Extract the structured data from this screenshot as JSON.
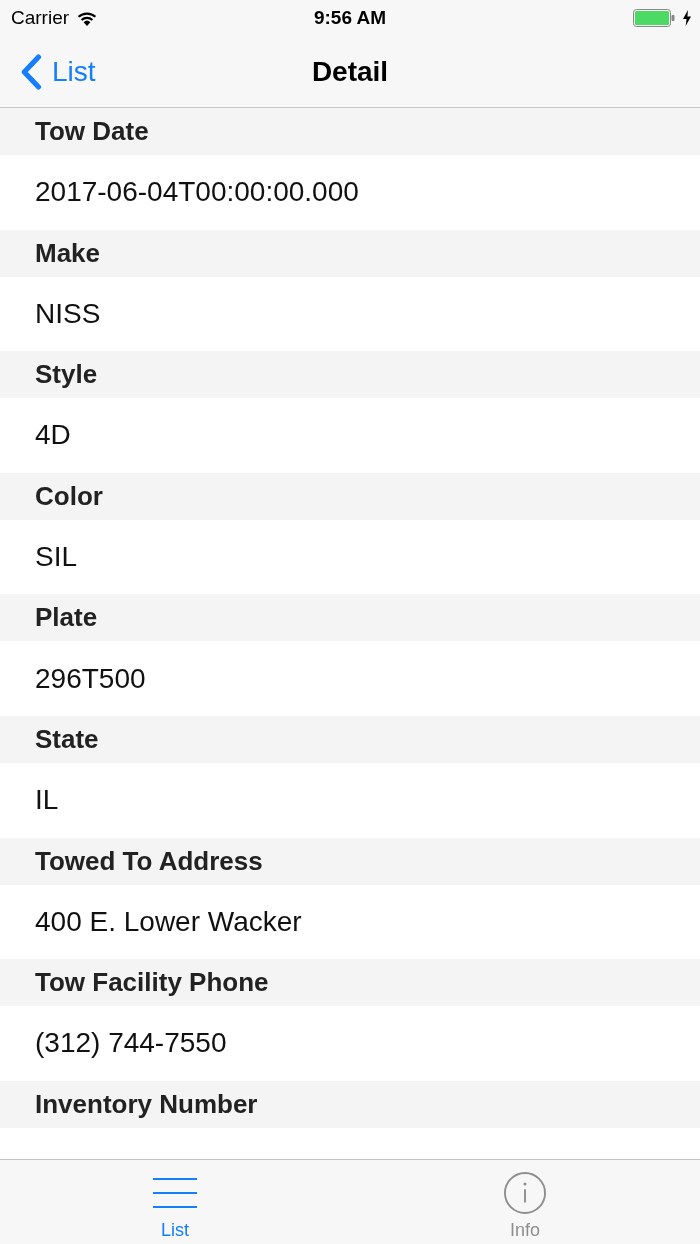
{
  "status_bar": {
    "carrier": "Carrier",
    "time": "9:56 AM",
    "charging": true
  },
  "nav_bar": {
    "back_label": "List",
    "title": "Detail"
  },
  "fields": [
    {
      "label": "Tow Date",
      "value": "2017-06-04T00:00:00.000"
    },
    {
      "label": "Make",
      "value": "NISS"
    },
    {
      "label": "Style",
      "value": "4D"
    },
    {
      "label": "Color",
      "value": "SIL"
    },
    {
      "label": "Plate",
      "value": "296T500"
    },
    {
      "label": "State",
      "value": "IL"
    },
    {
      "label": "Towed To Address",
      "value": "400 E. Lower Wacker"
    },
    {
      "label": "Tow Facility Phone",
      "value": "(312) 744-7550"
    },
    {
      "label": "Inventory Number"
    }
  ],
  "tab_bar": [
    {
      "kind": "list",
      "label": "List",
      "selected": true
    },
    {
      "kind": "info",
      "label": "Info",
      "selected": false
    }
  ]
}
